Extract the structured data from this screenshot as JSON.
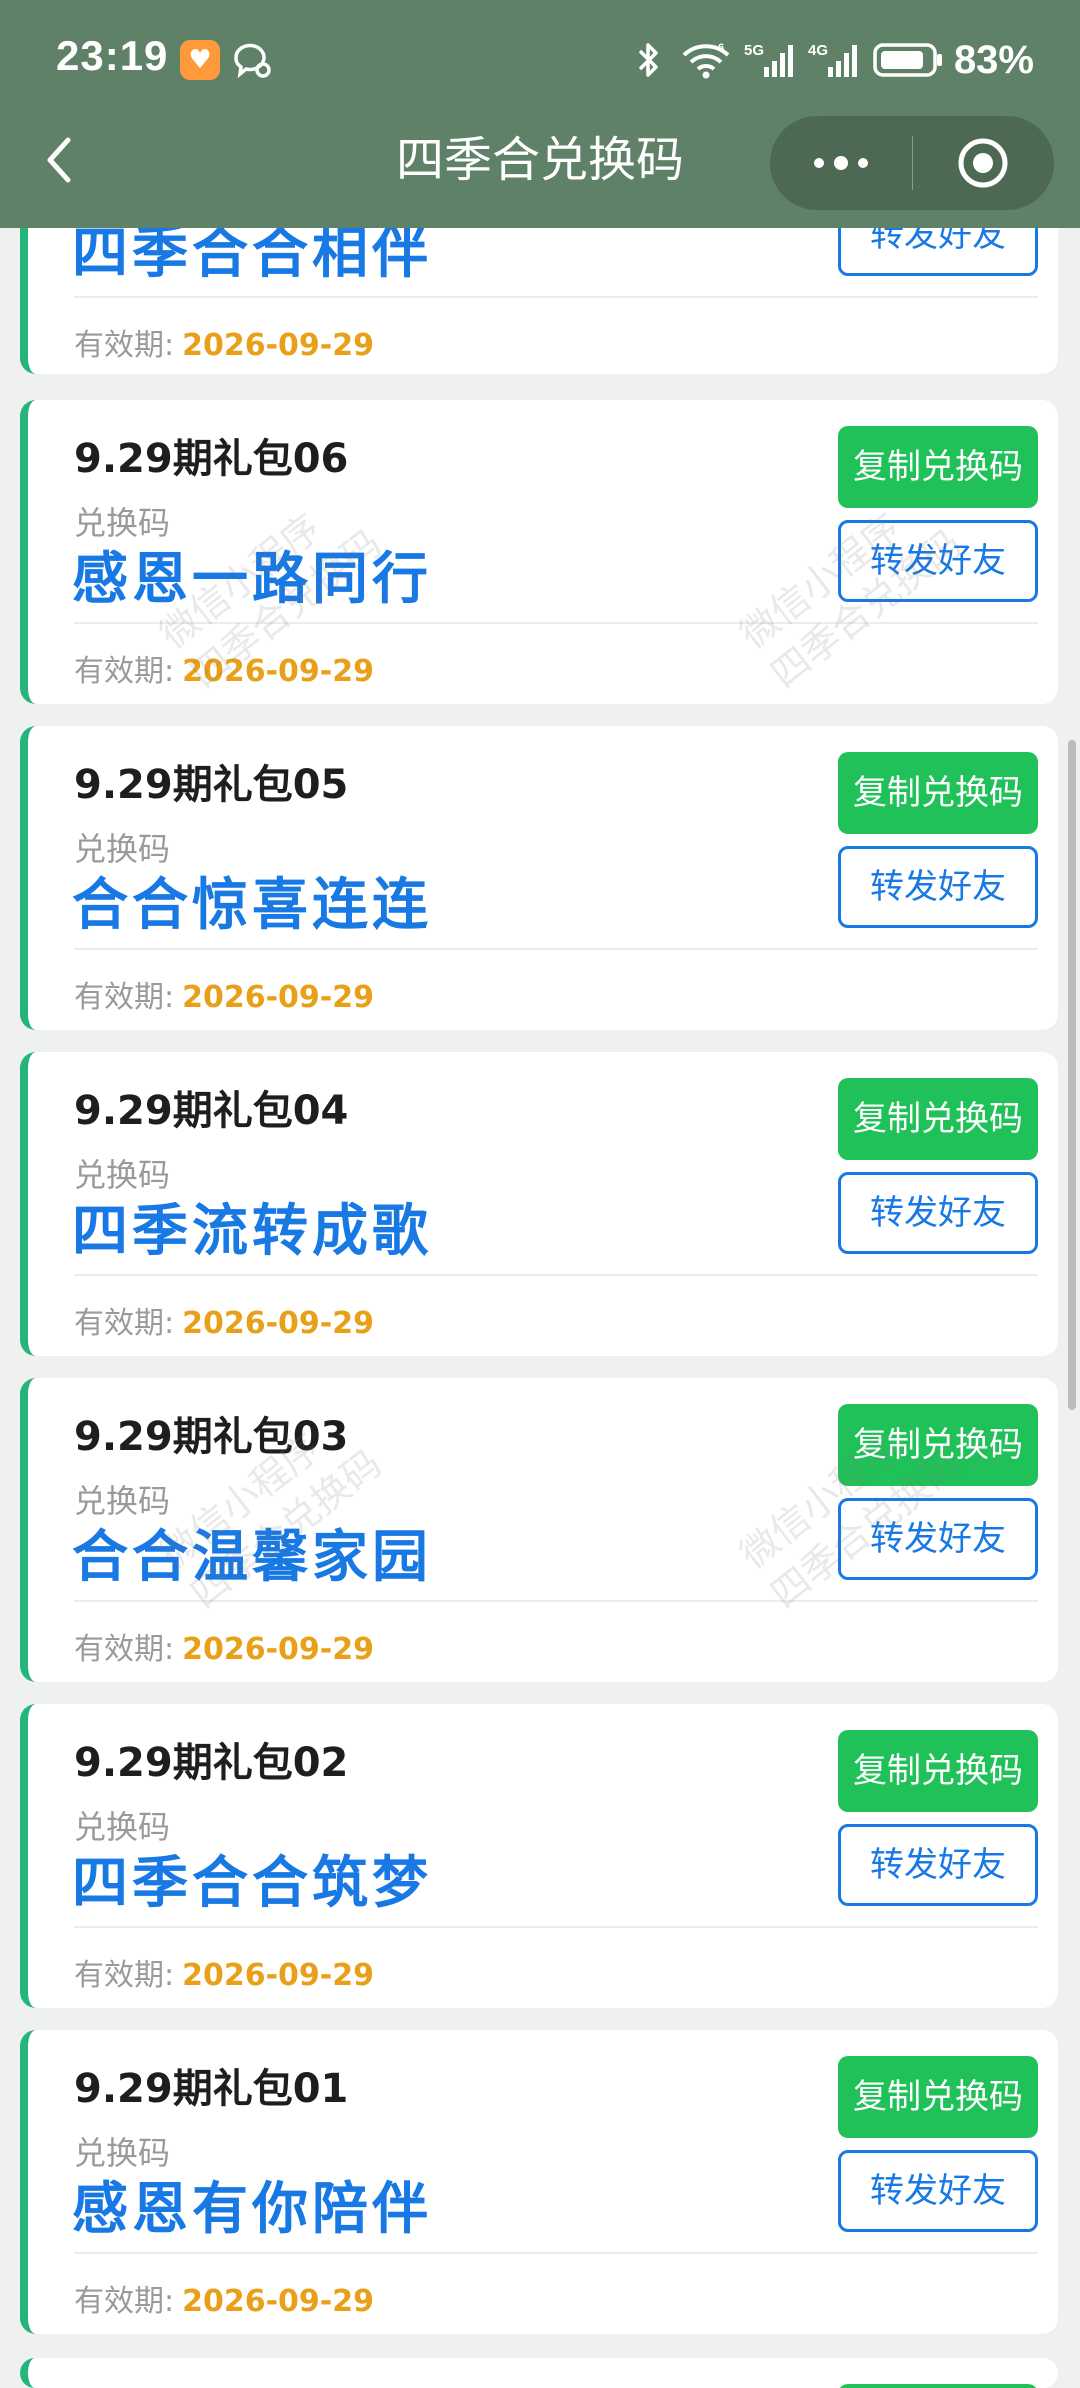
{
  "status_bar": {
    "time": "23:19",
    "battery": "83%",
    "icons": [
      "app-icon",
      "chat-bubble-icon",
      "bluetooth-icon",
      "wifi-icon",
      "signal-5g-icon",
      "signal-4g-icon",
      "battery-icon"
    ]
  },
  "nav": {
    "title": "四季合兑换码",
    "back_icon": "chevron-left-icon",
    "menu_icon": "more-dots-icon",
    "close_icon": "record-target-icon"
  },
  "labels": {
    "code_label": "兑换码",
    "expire_label": "有效期:",
    "copy_button": "复制兑换码",
    "share_button": "转发好友"
  },
  "cards": [
    {
      "name": "",
      "code": "四季合合相伴",
      "expire": "2026-09-29"
    },
    {
      "name": "9.29期礼包06",
      "code": "感恩一路同行",
      "expire": "2026-09-29"
    },
    {
      "name": "9.29期礼包05",
      "code": "合合惊喜连连",
      "expire": "2026-09-29"
    },
    {
      "name": "9.29期礼包04",
      "code": "四季流转成歌",
      "expire": "2026-09-29"
    },
    {
      "name": "9.29期礼包03",
      "code": "合合温馨家园",
      "expire": "2026-09-29"
    },
    {
      "name": "9.29期礼包02",
      "code": "四季合合筑梦",
      "expire": "2026-09-29"
    },
    {
      "name": "9.29期礼包01",
      "code": "感恩有你陪伴",
      "expire": "2026-09-29"
    }
  ],
  "watermark": {
    "line1": "微信小程序",
    "line2": "四季合兑换码"
  },
  "colors": {
    "header_bg": "#5e8167",
    "accent_green": "#21c15a",
    "accent_blue": "#1878e4",
    "expire_orange": "#e8a019",
    "card_border": "#25b57c"
  }
}
